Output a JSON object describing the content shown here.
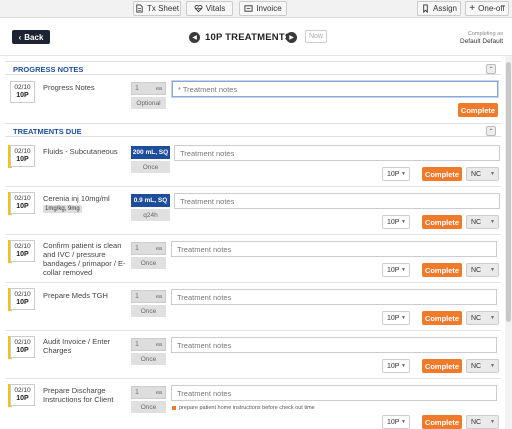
{
  "topbar": {
    "tx_sheet": "Tx Sheet",
    "vitals": "Vitals",
    "invoice": "Invoice",
    "assign": "Assign",
    "one_off": "One-off"
  },
  "header": {
    "back": "Back",
    "title": "10P TREATMENTS",
    "now": "Now",
    "completing_as_label": "Completing as",
    "completing_as_user": "Default Default"
  },
  "progress_notes": {
    "section_title": "PROGRESS NOTES",
    "date": "02/10",
    "hour": "10P",
    "name": "Progress Notes",
    "qty": "1",
    "unit": "ea",
    "freq": "Optional",
    "notes_placeholder": "* Treatment notes",
    "complete": "Complete"
  },
  "treatments": {
    "section_title": "TREATMENTS DUE",
    "complete_label": "Complete",
    "notes_placeholder": "Treatment notes",
    "nc_label": "NC",
    "items": [
      {
        "date": "02/10",
        "hour": "10P",
        "name": "Fluids - Subcutaneous",
        "qty": "200 mL, SQ",
        "freq": "Once",
        "time": "10P"
      },
      {
        "date": "02/10",
        "hour": "10P",
        "name": "Cerenia inj 10mg/ml",
        "dose": "1mg/kg, 9mg",
        "qty": "0.9 mL, SQ",
        "freq": "q24h",
        "time": "10P"
      },
      {
        "date": "02/10",
        "hour": "10P",
        "name": "Confirm patient is clean and IVC / pressure bandages / primapor / E-collar removed",
        "qty": "1",
        "unit": "ea",
        "freq": "Once",
        "time": "10P"
      },
      {
        "date": "02/10",
        "hour": "10P",
        "name": "Prepare Meds TGH",
        "qty": "1",
        "unit": "ea",
        "freq": "Once",
        "time": "10P"
      },
      {
        "date": "02/10",
        "hour": "10P",
        "name": "Audit Invoice / Enter Charges",
        "qty": "1",
        "unit": "ea",
        "freq": "Once",
        "time": "10P"
      },
      {
        "date": "02/10",
        "hour": "10P",
        "name": "Prepare Discharge Instructions for Client",
        "qty": "1",
        "unit": "ea",
        "freq": "Once",
        "time": "10P",
        "instruction": "prepare patient home instructions before check out time"
      }
    ]
  }
}
